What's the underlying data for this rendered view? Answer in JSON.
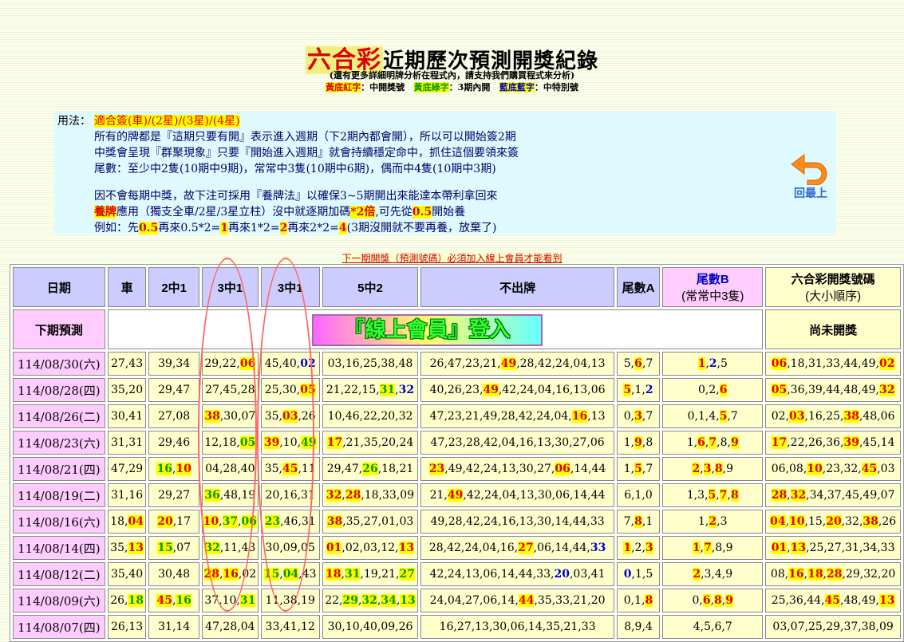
{
  "header": {
    "brand": "六合彩",
    "title_rest": "近期歷次預測開獎紀錄",
    "subtitle": "(還有更多詳細明牌分析在程式內，請支持我們購買程式來分析)",
    "legend_red_key": "黃底紅字",
    "legend_red_desc": "：中開獎號",
    "legend_green_key": "黃底綠字",
    "legend_green_desc": "：3期內開",
    "legend_blue_key": "藍底藍字",
    "legend_blue_desc": "：中特別號"
  },
  "usage": {
    "label": "用法：",
    "l1": "適合簽(車)/(2星)/(3星)/(4星)",
    "l2": "所有的牌都是『這期只要有開』表示進入週期（下2期內都會開），所以可以開始簽2期",
    "l3": "中獎會呈現『群聚現象』只要『開始進入週期』就會持續穩定命中，抓住這個要領來簽",
    "l4": "尾數：至少中2隻(10期中9期)，常常中3隻(10期中6期)，偶而中4隻(10期中3期)",
    "l5": "因不會每期中獎，故下注可採用『養牌法』以確保3~5期開出來能達本帶利拿回來",
    "l6a": "養牌",
    "l6b": "應用（獨支全車/2星/3星立柱）沒中就逐期加碼",
    "l6c": "*2倍",
    "l6d": ",可先從",
    "l6e": "0.5",
    "l6f": "開始養",
    "l7a": "例如：先",
    "l7b": "0.5",
    "l7c": "再來0.5*2=",
    "l7d": "1",
    "l7e": "再來1*2=",
    "l7f": "2",
    "l7g": "再來2*2=",
    "l7h": "4",
    "l7i": "(3期沒開就不要再養，放棄了)",
    "back_label": "回最上"
  },
  "next_link": "下一期開獎（預測號碼）必須加入線上會員才能看到",
  "table": {
    "headers": {
      "date": "日期",
      "car": "車",
      "two": "2中1",
      "three_a": "3中1",
      "three_b": "3中1",
      "five": "5中2",
      "nogo": "不出牌",
      "tailA": "尾數A",
      "tailB_1": "尾數B",
      "tailB_2": "(常常中3隻)",
      "draw_1": "六合彩開獎號碼",
      "draw_2": "(大小順序)"
    },
    "pred_label": "下期預測",
    "login_text": "『線上會員』登入",
    "pred_status": "尚未開獎",
    "rows": [
      {
        "date": "114/08/30(六)",
        "car": "27,43",
        "two": "39,34",
        "threeA": "29,22,[y:06]",
        "threeB": "45,40,[b:02]",
        "five": "03,16,25,38,48",
        "nogo": "26,47,23,21,[y:49],28,42,24,04,13",
        "tA": "5,[y:6],7",
        "tB": "[y:1],[b:2],5",
        "draw": "[y:06],18,31,33,44,49,[y:02]"
      },
      {
        "date": "114/08/28(四)",
        "car": "35,20",
        "two": "29,47",
        "threeA": "27,45,28",
        "threeB": "25,30,[y:05]",
        "five": "21,22,15,[g:31],[b:32]",
        "nogo": "40,26,23,[y:49],42,24,04,16,13,06",
        "tA": "[y:5],1,[b:2]",
        "tB": "0,2,[y:6]",
        "draw": "[y:05],36,39,44,48,49,[y:32]"
      },
      {
        "date": "114/08/26(二)",
        "car": "30,41",
        "two": "27,08",
        "threeA": "[y:38],30,07",
        "threeB": "35,[y:03],26",
        "five": "10,46,22,20,32",
        "nogo": "47,23,21,49,28,42,24,04,[y:16],13",
        "tA": "0,[y:3],7",
        "tB": "0,1,4,[y:5],7",
        "draw": "02,[y:03],16,25,[y:38],48,06"
      },
      {
        "date": "114/08/23(六)",
        "car": "31,31",
        "two": "29,46",
        "threeA": "12,18,[g:05]",
        "threeB": "[y:39],10,[g:49]",
        "five": "[y:17],21,35,20,24",
        "nogo": "47,23,28,42,04,16,13,30,27,06",
        "tA": "1,[y:9],8",
        "tB": "1,[y:6],[y:7],8,[y:9]",
        "draw": "[y:17],22,26,36,[y:39],45,14"
      },
      {
        "date": "114/08/21(四)",
        "car": "47,29",
        "two": "[g:16],[y:10]",
        "threeA": "04,28,40",
        "threeB": "35,[y:45],11",
        "five": "29,47,[g:26],18,21",
        "nogo": "[y:23],49,42,24,13,30,27,[y:06],14,44",
        "tA": "1,[y:5],7",
        "tB": "[y:2],[y:3],[y:8],9",
        "draw": "06,08,[y:10],23,32,[y:45],03"
      },
      {
        "date": "114/08/19(二)",
        "car": "31,16",
        "two": "29,27",
        "threeA": "[g:36],48,19",
        "threeB": "20,16,31",
        "five": "[y:32],[y:28],18,33,09",
        "nogo": "21,[y:49],42,24,04,13,30,06,14,44",
        "tA": "6,1,0",
        "tB": "1,3,[y:5],[y:7],[y:8]",
        "draw": "[y:28],[y:32],34,37,45,49,07"
      },
      {
        "date": "114/08/16(六)",
        "car": "18,[y:04]",
        "two": "[y:20],17",
        "threeA": "[y:10],[g:37],[g:06]",
        "threeB": "[g:23],46,31",
        "five": "[y:38],35,27,01,03",
        "nogo": "49,28,42,24,16,13,30,14,44,33",
        "tA": "7,[y:8],1",
        "tB": "1,[y:2],3",
        "draw": "[y:04],[y:10],15,[y:20],32,[y:38],26"
      },
      {
        "date": "114/08/14(四)",
        "car": "35,[y:13]",
        "two": "[g:15],07",
        "threeA": "[g:32],11,43",
        "threeB": "30,09,05",
        "five": "[y:01],02,03,12,[y:13]",
        "nogo": "28,42,24,04,16,[y:27],06,14,44,[b:33]",
        "tA": "[y:1],2,[y:3]",
        "tB": "[y:1],[y:7],8,9",
        "draw": "[y:01],[y:13],25,27,31,34,33"
      },
      {
        "date": "114/08/12(二)",
        "car": "35,40",
        "two": "30,48",
        "threeA": "[y:28],[y:16],02",
        "threeB": "[g:15],[g:04],43",
        "five": "[y:18],[g:31],19,21,[g:27]",
        "nogo": "42,24,13,06,14,44,33,[b:20],03,41",
        "tA": "[b:0],1,5",
        "tB": "[y:2],3,4,9",
        "draw": "08,[y:16],[y:18],[y:28],29,32,20"
      },
      {
        "date": "114/08/09(六)",
        "car": "26,[g:18]",
        "two": "[y:45],[g:16]",
        "threeA": "37,10,[g:31]",
        "threeB": "11,38,19",
        "five": "22,[g:29],[g:32],[g:34],[g:13]",
        "nogo": "24,04,27,06,14,[y:44],35,33,21,20",
        "tA": "0,1,[y:8]",
        "tB": "0,[y:6],[y:8],[y:9]",
        "draw": "25,36,44,[y:45],48,49,[y:13]"
      },
      {
        "date": "114/08/07(四)",
        "car": "26,13",
        "two": "31,14",
        "threeA": "47,28,04",
        "threeB": "33,41,12",
        "five": "30,10,40,09,26",
        "nogo": "16,27,13,30,06,14,35,21,33",
        "tA": "8,9,4",
        "tB": "4,5,6,7",
        "draw": "03,07,25,29,37,38,09"
      }
    ]
  }
}
